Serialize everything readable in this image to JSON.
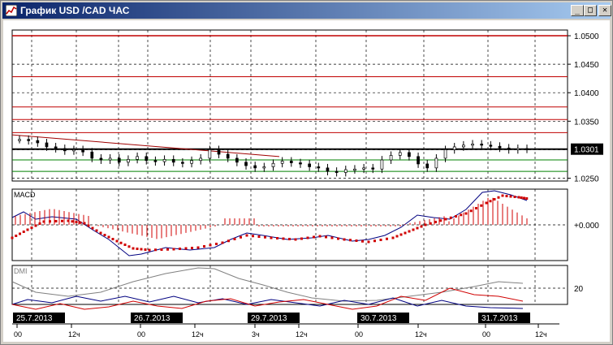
{
  "window": {
    "title": "График USD /CAD  ЧАС",
    "buttons": [
      {
        "name": "minimize-button",
        "glyph": "_"
      },
      {
        "name": "maximize-button",
        "glyph": "□"
      },
      {
        "name": "close-button",
        "glyph": "✕"
      }
    ]
  },
  "colors": {
    "background": "#ffffff",
    "grid": "#000000",
    "resistance_line": "#c00000",
    "support_line": "#008000",
    "trend_line": "#a00000",
    "candles": "#000000",
    "macd_main": "#000080",
    "macd_signal": "#d00000",
    "macd_hist": "#d00000",
    "dmi_adx": "#808080",
    "dmi_plus": "#000080",
    "dmi_minus": "#d00000"
  },
  "price_panel": {
    "price_ticks": [
      "1.0500",
      "1.0450",
      "1.0400",
      "1.0350",
      "1.0301",
      "1.0250"
    ],
    "current_price": "1.0301",
    "horizontal_levels": {
      "red": [
        1.05,
        1.0428,
        1.0375,
        1.0353,
        1.033
      ],
      "black": [
        1.0301
      ],
      "green": [
        1.0282,
        1.0262
      ]
    }
  },
  "macd_panel": {
    "label": "MACD",
    "zero_label": "+0.000"
  },
  "dmi_panel": {
    "label": "DMI",
    "level_label": "20"
  },
  "x_axis": {
    "date_labels": [
      "25.7.2013",
      "26.7.2013",
      "29.7.2013",
      "30.7.2013",
      "31.7.2013"
    ],
    "hour_ticks": [
      "00",
      "12ч",
      "00",
      "12ч",
      "3ч",
      "12ч",
      "00",
      "12ч",
      "00",
      "12ч"
    ]
  },
  "chart_data": {
    "type": "line",
    "title": "",
    "series": [
      {
        "name": "USD/CAD",
        "values": [
          1.0318,
          1.0316,
          1.0312,
          1.0305,
          1.0302,
          1.0298,
          1.03,
          1.0296,
          1.0285,
          1.0282,
          1.0285,
          1.0278,
          1.0283,
          1.0288,
          1.0281,
          1.0279,
          1.0283,
          1.0278,
          1.0276,
          1.0281,
          1.0285,
          1.03,
          1.0292,
          1.0285,
          1.0278,
          1.0272,
          1.0268,
          1.027,
          1.0276,
          1.028,
          1.0277,
          1.0275,
          1.027,
          1.0268,
          1.0262,
          1.026,
          1.0265,
          1.0266,
          1.0268,
          1.0266,
          1.0282,
          1.029,
          1.0295,
          1.0288,
          1.0275,
          1.0268,
          1.0285,
          1.03,
          1.0305,
          1.0308,
          1.031,
          1.0308,
          1.0306,
          1.0303,
          1.03,
          1.0302,
          1.0301
        ]
      }
    ],
    "ylim": [
      1.0245,
      1.051
    ],
    "grid": true
  }
}
